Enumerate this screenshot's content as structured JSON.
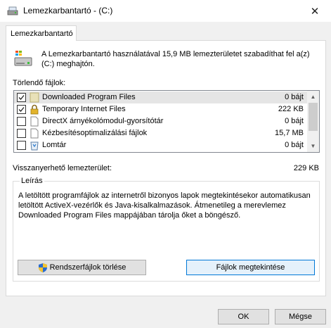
{
  "window": {
    "title": "Lemezkarbantartó  -  (C:)",
    "close_glyph": "✕"
  },
  "tab": {
    "label": "Lemezkarbantartó"
  },
  "intro_text": "A Lemezkarbantartó használatával 15,9 MB lemezterületet szabadíthat fel a(z)  (C:) meghajtón.",
  "files_label": "Törlendő fájlok:",
  "files": [
    {
      "name": "Downloaded Program Files",
      "size": "0 bájt",
      "checked": true,
      "icon": "folder-icon",
      "selected": true
    },
    {
      "name": "Temporary Internet Files",
      "size": "222 KB",
      "checked": true,
      "icon": "lock-icon",
      "selected": false
    },
    {
      "name": "DirectX árnyékolómodul-gyorsítótár",
      "size": "0 bájt",
      "checked": false,
      "icon": "blank-file-icon",
      "selected": false
    },
    {
      "name": "Kézbesítésoptimalizálási fájlok",
      "size": "15,7 MB",
      "checked": false,
      "icon": "blank-file-icon",
      "selected": false
    },
    {
      "name": "Lomtár",
      "size": "0 bájt",
      "checked": false,
      "icon": "recycle-bin-icon",
      "selected": false
    }
  ],
  "gain": {
    "label": "Visszanyerhető lemezterület:",
    "value": "229 KB"
  },
  "description": {
    "legend": "Leírás",
    "text": "A letöltött programfájlok az internetről bizonyos lapok megtekintésekor automatikusan letöltött ActiveX-vezérlők és Java-kisalkalmazások. Átmenetileg a merevlemez Downloaded Program Files mappájában tárolja őket a böngésző."
  },
  "buttons": {
    "clean_system": "Rendszerfájlok törlése",
    "view_files": "Fájlok megtekintése",
    "ok": "OK",
    "cancel": "Mégse"
  },
  "colors": {
    "accent": "#0078d7",
    "selected_row": "#e5e5e5"
  }
}
